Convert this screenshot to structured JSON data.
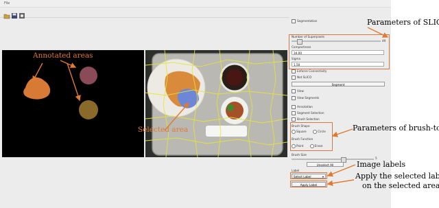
{
  "menu": {
    "file": "File"
  },
  "toolbar": {
    "icons": [
      "open-icon",
      "save-icon",
      "settings-icon"
    ]
  },
  "segmentation": {
    "section_label": "Segmentation",
    "num_superpixels_label": "Number of Superpixels",
    "num_superpixels_value": "49",
    "num_superpixels_fraction": 0.08,
    "compactness_label": "Compactness",
    "compactness_value": "34.00",
    "sigma_label": "Sigma",
    "sigma_value": "1.50",
    "enforce_connectivity": "Enforce Connectivity",
    "not_slico": "Not SLICO",
    "segment_button": "Segment"
  },
  "view": {
    "view_label": "View",
    "view_segments": "View Segments",
    "annotation": "Annotation",
    "segment_selection": "Segment Selection",
    "brush_selection": "Brush Selection"
  },
  "brush": {
    "shape_label": "Brush Shape",
    "square": "Square",
    "circle": "Circle",
    "function_label": "Brush Function",
    "paint": "Paint",
    "erase": "Erase",
    "size_label": "Brush Size",
    "size_value": "5",
    "size_fraction": 0.62,
    "unselect_all": "Unselect All"
  },
  "labels": {
    "label_title": "Label",
    "select_label": "Select Label",
    "apply_label": "Apply Label"
  },
  "annotations": {
    "annotated_areas": "Annotated areas",
    "selected_area": "Selected area",
    "slic_params": "Parameters of SLIC",
    "brush_params": "Parameters of brush-tool",
    "image_labels": "Image labels",
    "apply_line1": "Apply the selected label",
    "apply_line2": "on the selected area"
  },
  "colors": {
    "accent": "#d8773b",
    "superpixel": "#e6e43a"
  }
}
